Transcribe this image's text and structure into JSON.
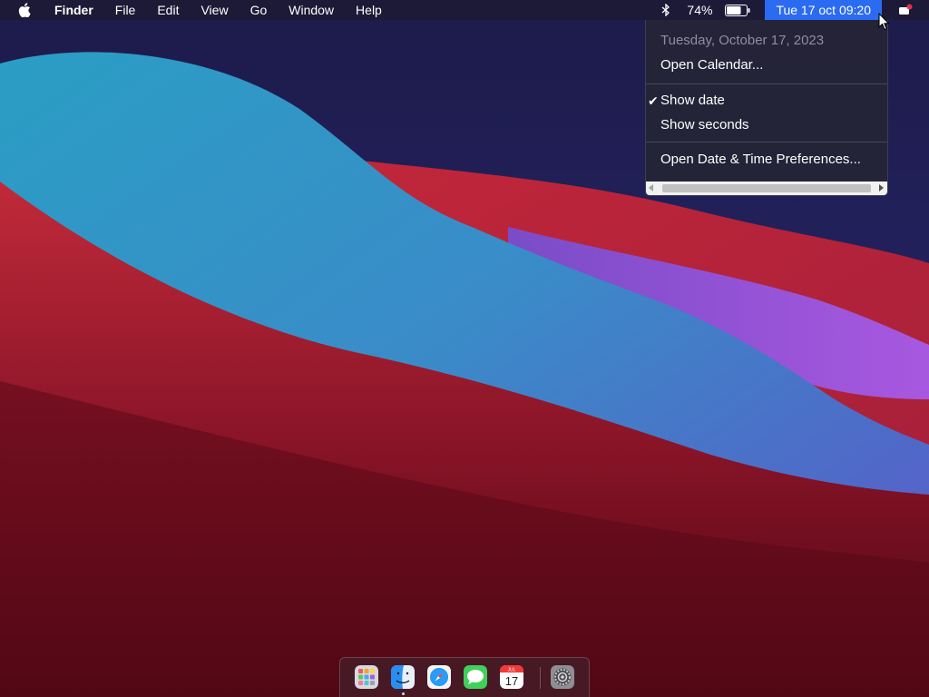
{
  "menubar": {
    "app_name": "Finder",
    "menus": [
      "File",
      "Edit",
      "View",
      "Go",
      "Window",
      "Help"
    ],
    "battery_percent": "74%",
    "battery_level": 0.74,
    "clock": "Tue 17 oct 09:20",
    "icons": [
      "apple-icon",
      "bluetooth-icon",
      "battery-icon",
      "notification-center-icon"
    ]
  },
  "clock_menu": {
    "date_header": "Tuesday, October 17, 2023",
    "open_calendar": "Open Calendar...",
    "show_date": "Show date",
    "show_date_checked": true,
    "show_seconds": "Show seconds",
    "open_prefs": "Open Date & Time Preferences..."
  },
  "dock": {
    "items": [
      "launchpad-icon",
      "finder-icon",
      "safari-icon",
      "messages-icon",
      "calendar-icon",
      "system-preferences-icon"
    ],
    "calendar_month": "JUL",
    "calendar_day": "17"
  },
  "colors": {
    "menubar_bg": "#1c1a34",
    "highlight": "#2a6bf2",
    "menu_bg": "#242438"
  }
}
